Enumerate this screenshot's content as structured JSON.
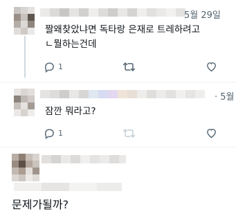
{
  "tweet1": {
    "date": "5월 29일",
    "text_line1": "짤왜찾았냐면 독타랑 은재로 트레하려고",
    "text_line2": "ㄴ뭘하는건데",
    "reply_count": "1",
    "icons": {
      "reply": "reply-icon",
      "retweet": "retweet-icon",
      "like": "heart-icon"
    }
  },
  "tweet2": {
    "date": "· 5월",
    "text": "잠깐 뭐라고?",
    "reply_count": "1",
    "icons": {
      "reply": "reply-icon",
      "retweet": "retweet-icon",
      "like": "heart-icon"
    }
  },
  "tweet3": {
    "text": "문제가될까?"
  },
  "colors": {
    "text": "#0f1419",
    "muted": "#536471",
    "retweet_disabled": "#c4cfd6",
    "thread_line": "#cfd9de"
  }
}
